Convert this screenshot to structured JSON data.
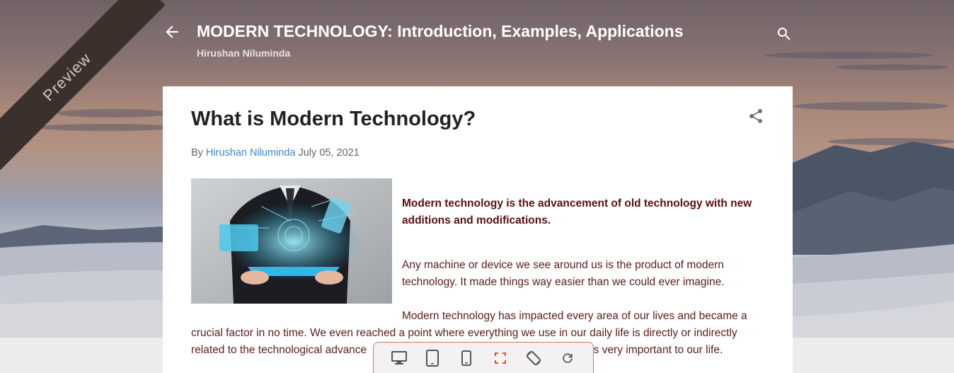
{
  "header": {
    "ribbon_label": "Preview",
    "blog_title": "MODERN TECHNOLOGY: Introduction, Examples, Applications",
    "blog_author": "Hirushan Niluminda"
  },
  "post": {
    "title": "What is Modern Technology?",
    "by_prefix": "By",
    "author": "Hirushan Niluminda",
    "date": "July 05, 2021",
    "intro_bold": " Modern technology is the advancement of old technology with new additions and modifications.",
    "para1": "Any machine or device we see around us is the product of modern technology. It made things way easier than we could ever imagine.",
    "para2_start": "Modern technology has impacted every area of our lives and became a",
    "para2_line2": "crucial factor in no time. We even reached a point where everything we use in our daily life is directly or indirectly",
    "para2_line3a": "related to the technological advance",
    "para2_line3b": "is very important to our life."
  },
  "toolbar": {
    "items": [
      "desktop-view",
      "tablet-view",
      "mobile-view",
      "fullscreen",
      "rotate",
      "refresh"
    ],
    "accent": "#d7765a"
  },
  "colors": {
    "link": "#3d87c4",
    "body_text": "#5a1c1c",
    "ribbon": "#3b302c"
  }
}
